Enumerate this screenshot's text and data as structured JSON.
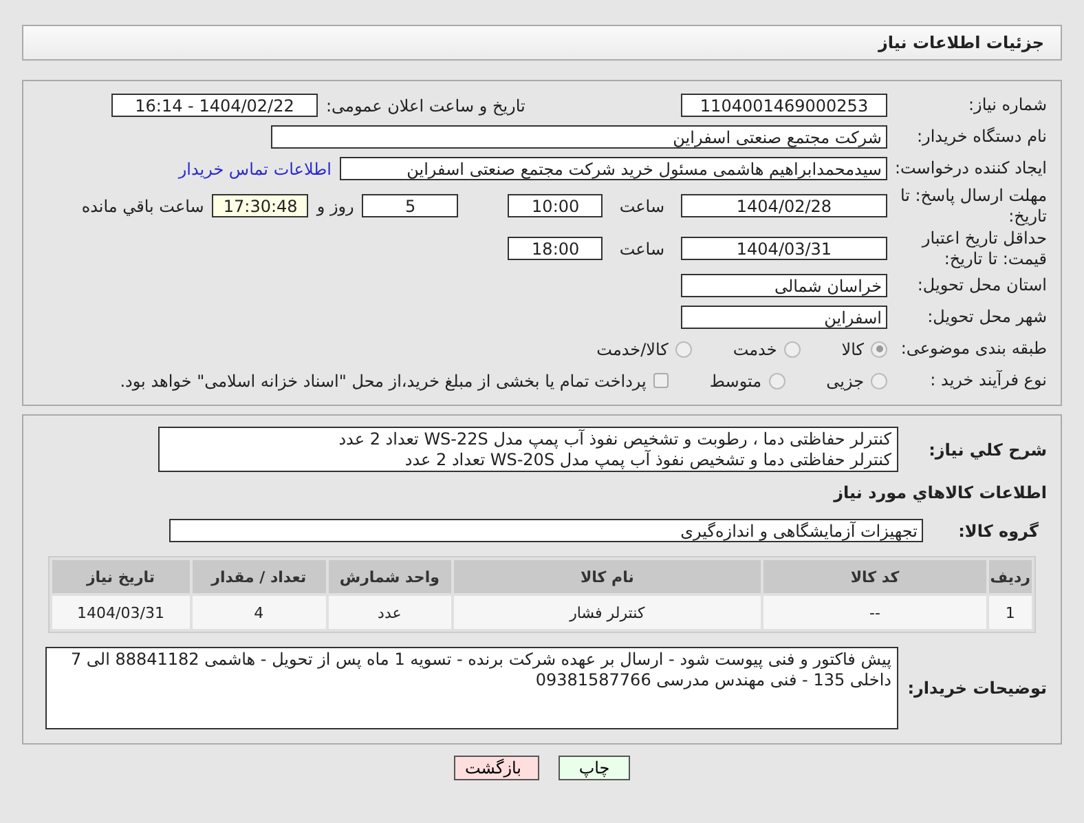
{
  "header": {
    "title": "جزئیات اطلاعات نیاز"
  },
  "form": {
    "need_number": {
      "label": "شماره نیاز:",
      "value": "1104001469000253"
    },
    "announce": {
      "label": "تاریخ و ساعت اعلان عمومی:",
      "value": "1404/02/22 - 16:14"
    },
    "buyer_org": {
      "label": "نام دستگاه خریدار:",
      "value": "شرکت مجتمع صنعتی اسفراین"
    },
    "requester": {
      "label": "ایجاد کننده درخواست:",
      "value": "سیدمحمدابراهیم هاشمی مسئول خرید شرکت مجتمع صنعتی اسفراین",
      "link": "اطلاعات تماس خریدار"
    },
    "reply_deadline": {
      "label": "مهلت ارسال پاسخ: تا تاریخ:",
      "date": "1404/02/28",
      "time_label": "ساعت",
      "time": "10:00",
      "days": "5",
      "days_label": "روز و",
      "remaining": "17:30:48",
      "remaining_label": "ساعت باقي مانده"
    },
    "price_validity": {
      "label": "حداقل تاریخ اعتبار قیمت: تا تاریخ:",
      "date": "1404/03/31",
      "time_label": "ساعت",
      "time": "18:00"
    },
    "province": {
      "label": "استان محل تحویل:",
      "value": "خراسان شمالی"
    },
    "city": {
      "label": "شهر محل تحویل:",
      "value": "اسفراین"
    },
    "category": {
      "label": "طبقه بندی موضوعی:",
      "options": [
        {
          "label": "کالا",
          "selected": true
        },
        {
          "label": "خدمت",
          "selected": false
        },
        {
          "label": "کالا/خدمت",
          "selected": false
        }
      ]
    },
    "process": {
      "label": "نوع فرآیند خرید :",
      "options": [
        {
          "label": "جزیی",
          "selected": false
        },
        {
          "label": "متوسط",
          "selected": false
        }
      ],
      "treasury": {
        "label": "پرداخت تمام یا بخشی از مبلغ خرید،از محل \"اسناد خزانه اسلامی\" خواهد بود.",
        "checked": false
      }
    }
  },
  "description": {
    "label": "شرح کلي نياز:",
    "text": "کنترلر حفاظتی دما ، رطوبت و تشخیص نفوذ آب پمپ مدل WS-22S تعداد 2 عدد\nکنترلر حفاظتی دما و تشخیص نفوذ آب پمپ مدل WS-20S تعداد 2 عدد"
  },
  "goods": {
    "heading": "اطلاعات کالاهاي مورد نياز",
    "group_label": "گروه کالا:",
    "group": "تجهیزات آزمایشگاهی و اندازه‌گیری",
    "table": {
      "columns": [
        "ردیف",
        "کد کالا",
        "نام کالا",
        "واحد شمارش",
        "تعداد / مقدار",
        "تاریخ نیاز"
      ],
      "rows": [
        [
          "1",
          "--",
          "کنترلر فشار",
          "عدد",
          "4",
          "1404/03/31"
        ]
      ]
    }
  },
  "buyer_notes": {
    "label": "توضیحات خریدار:",
    "text": "پیش فاکتور و فنی پیوست شود - ارسال بر عهده شرکت برنده - تسویه 1 ماه پس از تحویل - هاشمی 88841182 الی 7 داخلی 135 - فنی مهندس مدرسی 09381587766"
  },
  "buttons": [
    {
      "label": "چاپ",
      "kind": "print"
    },
    {
      "label": "بازگشت",
      "kind": "back"
    }
  ]
}
